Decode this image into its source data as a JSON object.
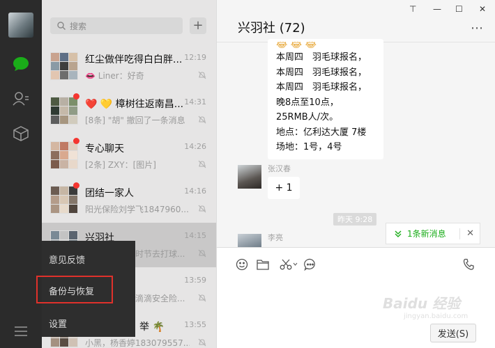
{
  "search": {
    "placeholder": "搜索"
  },
  "chats": [
    {
      "name": "红尘做伴吃得白白胖...",
      "time": "12:19",
      "preview": "👄 Liner：好奇",
      "unread": false
    },
    {
      "name": "❤️ 💛 樟树往返南昌...",
      "time": "14:31",
      "preview": "[8条] \"胡\" 撤回了一条消息",
      "unread": true
    },
    {
      "name": "专心聊天",
      "time": "14:26",
      "preview": "[2条] ZXY：[图片]",
      "unread": true
    },
    {
      "name": "团结一家人",
      "time": "14:16",
      "preview": "阳光保险刘学飞1847960...",
      "unread": true
    },
    {
      "name": "兴羽社",
      "time": "14:15",
      "preview": "时节去打球...",
      "unread": false
    },
    {
      "name": "",
      "time": "13:59",
      "preview": "滴滴安全险...",
      "unread": false
    },
    {
      "name": "举 🌴",
      "time": "13:55",
      "preview": "小黑，杨香婷183079557...",
      "unread": false
    }
  ],
  "menu": {
    "feedback": "意见反馈",
    "backup": "备份与恢复",
    "settings": "设置"
  },
  "chat": {
    "title": "兴羽社 (72)",
    "message_lines": [
      "本周四　羽毛球报名，",
      "本周四　羽毛球报名，",
      "本周四　羽毛球报名，",
      "晚8点至10点，",
      "25RMB人/次。",
      "地点：亿利达大厦 7楼",
      "场地：1号，4号"
    ],
    "sender1": "张汉春",
    "reply1": "+ 1",
    "timestamp": "昨天 9:28",
    "sender2": "李亮",
    "new_messages": "1条新消息",
    "send_label": "发送(S)"
  },
  "window": {
    "pin": "⊤",
    "minimize": "—",
    "maximize": "☐",
    "close": "✕"
  },
  "watermark": {
    "brand": "Baidu 经验",
    "url": "jingyan.baidu.com"
  },
  "colors": {
    "accent_green": "#1aad19",
    "highlight_red": "#e0312b",
    "rail": "#2b2b2b",
    "unread_dot": "#f43530"
  }
}
